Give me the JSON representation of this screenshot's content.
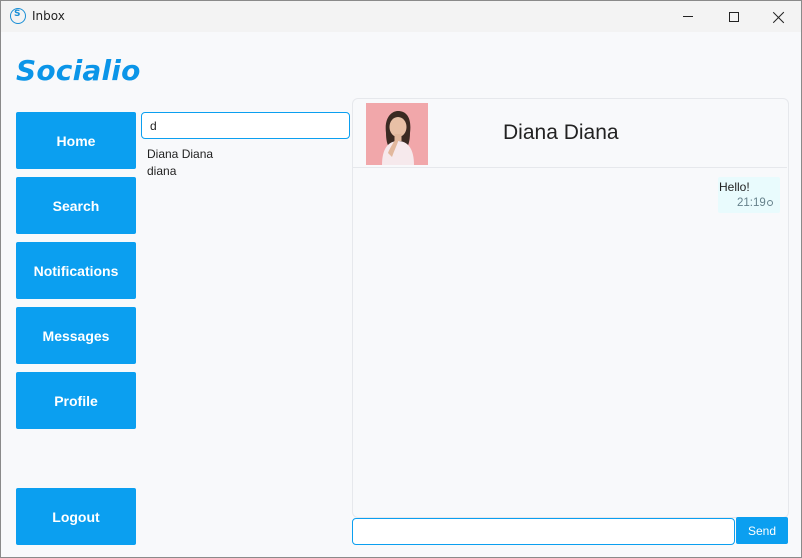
{
  "window": {
    "title": "Inbox",
    "icon": "app-logo-icon"
  },
  "brand": {
    "name": "Socialio",
    "color": "#0b95e8"
  },
  "nav": {
    "home": "Home",
    "search": "Search",
    "notifications": "Notifications",
    "messages": "Messages",
    "profile": "Profile",
    "logout": "Logout",
    "button_color": "#0b9ff0"
  },
  "search": {
    "value": "d",
    "results": [
      {
        "name": "Diana Diana",
        "username": "diana"
      }
    ]
  },
  "chat": {
    "contact_name": "Diana Diana",
    "messages": [
      {
        "text": "Hello!",
        "time": "21:19",
        "status_icon": "sent-circle-icon"
      }
    ],
    "compose_value": "",
    "send_label": "Send"
  }
}
